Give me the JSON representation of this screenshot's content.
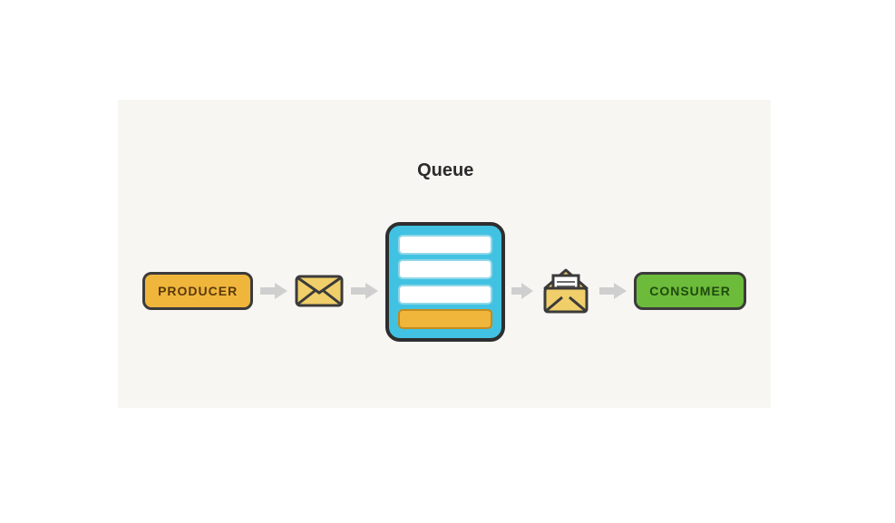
{
  "diagram": {
    "producer_label": "PRODUCER",
    "queue_label": "Queue",
    "consumer_label": "CONSUMER",
    "colors": {
      "producer_bg": "#f0b63c",
      "consumer_bg": "#6dbb3a",
      "queue_bg": "#42c2e2",
      "arrow": "#cfcfcf",
      "outline": "#3b3b3b"
    },
    "queue_slots": [
      {
        "filled": false
      },
      {
        "filled": false
      },
      {
        "filled": false
      },
      {
        "filled": true
      }
    ]
  }
}
